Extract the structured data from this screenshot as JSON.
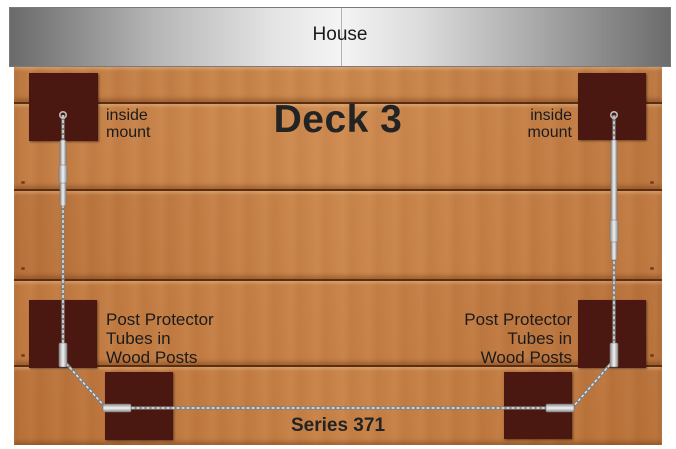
{
  "house": {
    "label": "House"
  },
  "deck": {
    "title": "Deck 3"
  },
  "labels": {
    "inside_mount_left": "inside\nmount",
    "inside_mount_right": "inside\nmount",
    "protector_left": "Post Protector\nTubes in\nWood Posts",
    "protector_right": "Post Protector\nTubes in\nWood Posts",
    "series": "Series 371"
  },
  "colors": {
    "post": "#4a1810",
    "cable": "#c9c9c9",
    "house_bar": "#b6b6b6",
    "deck_wood": "#c9864c"
  }
}
